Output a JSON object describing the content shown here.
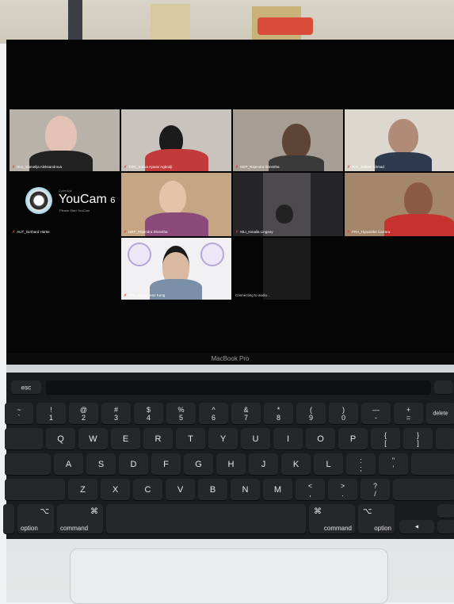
{
  "participants": [
    {
      "name": "BUL_Kamelija Aleksandrova"
    },
    {
      "name": "TOG_Sokva Ayaovi Agbodji"
    },
    {
      "name": "NEP_Rajendra Shrestha"
    },
    {
      "name": "PAK_Zaheer Ahmad"
    },
    {
      "name": "AUT_Gerhard Harke"
    },
    {
      "name": "NEP_Rajendra Shrestha"
    },
    {
      "name": "MLI_Ismaila Lingany"
    },
    {
      "name": "FRA_Hyacinthe Carrera"
    },
    {
      "name": "TPE_Helen-yean Kung"
    },
    {
      "name": "Connecting to audio..."
    }
  ],
  "youcam": {
    "brand": "Cyberlink",
    "title": "YouCam",
    "version": "6",
    "subtitle": "Please Start YouCam"
  },
  "laptop_label": "MacBook Pro",
  "keys": {
    "esc": "esc",
    "row1": [
      "~\n`",
      "!\n1",
      "@\n2",
      "#\n3",
      "$\n4",
      "%\n5",
      "^\n6",
      "&\n7",
      "*\n8",
      "(\n9",
      ")\n0",
      "—\n-",
      "+\n=",
      "delete"
    ],
    "row2": [
      "Q",
      "W",
      "E",
      "R",
      "T",
      "Y",
      "U",
      "I",
      "O",
      "P",
      "{\n[",
      "}\n]"
    ],
    "row3": [
      "A",
      "S",
      "D",
      "F",
      "G",
      "H",
      "J",
      "K",
      "L",
      ":\n;",
      "\"\n'"
    ],
    "row4": [
      "Z",
      "X",
      "C",
      "V",
      "B",
      "N",
      "M",
      "<\n,",
      ">\n.",
      "?\n/"
    ],
    "bottom_left": [
      {
        "sym": "⌥",
        "word": "option"
      },
      {
        "sym": "⌘",
        "word": "command"
      }
    ],
    "bottom_right": [
      {
        "sym": "⌘",
        "word": "command"
      },
      {
        "sym": "⌥",
        "word": "option"
      }
    ],
    "arrow_left": "◄"
  }
}
